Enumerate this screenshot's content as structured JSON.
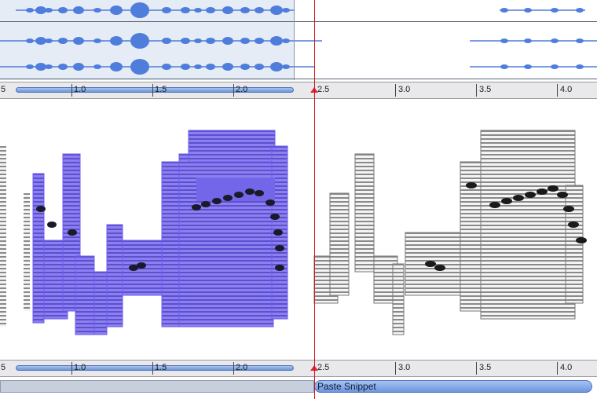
{
  "colors": {
    "waveform": "#4f7ddc",
    "selection": "#6a5de8",
    "playhead": "#d01515",
    "ruler_bar": "#6f95d8"
  },
  "ruler": {
    "ticks": [
      "1.0",
      "1.5",
      "2.0",
      "2.5",
      "3.0",
      "3.5",
      "4.0"
    ],
    "edge_label": "5"
  },
  "snippet": {
    "label": "Paste Snippet"
  }
}
